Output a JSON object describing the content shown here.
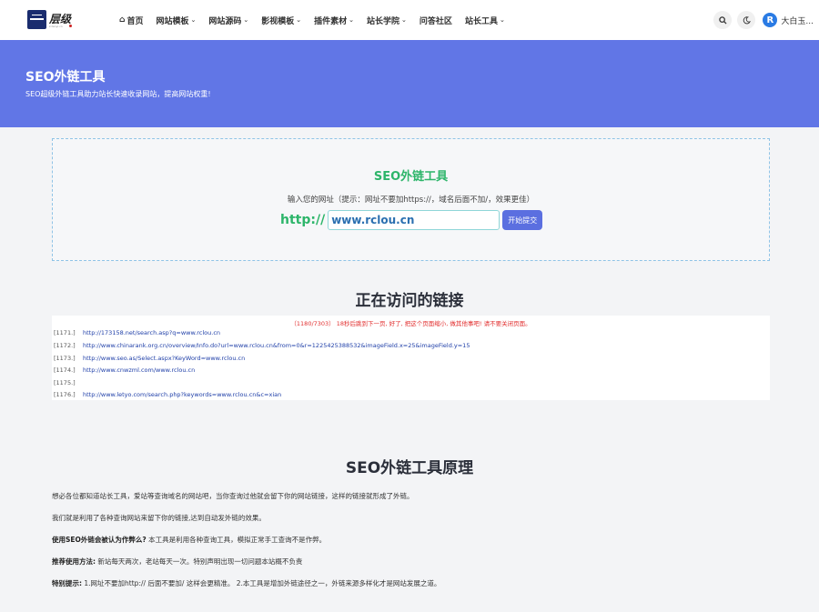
{
  "header": {
    "logo_text": "层级",
    "logo_sub": "z-tanyi.cn",
    "nav": [
      {
        "label": "首页",
        "has_menu": false,
        "icon": "home-icon"
      },
      {
        "label": "网站模板",
        "has_menu": true
      },
      {
        "label": "网站源码",
        "has_menu": true
      },
      {
        "label": "影视模板",
        "has_menu": true
      },
      {
        "label": "插件素材",
        "has_menu": true
      },
      {
        "label": "站长学院",
        "has_menu": true
      },
      {
        "label": "问答社区",
        "has_menu": false
      },
      {
        "label": "站长工具",
        "has_menu": true
      }
    ],
    "user_initial": "R",
    "user_name": "大白玉..."
  },
  "banner": {
    "title": "SEO外链工具",
    "subtitle": "SEO超级外链工具助力站长快速收录网站，提高网站权重!"
  },
  "tool": {
    "title": "SEO外链工具",
    "hint": "输入您的网址（提示：网址不要加https://，域名后面不加/，效果更佳）",
    "prefix": "http://",
    "url_value": "www.rclou.cn",
    "submit_label": "开始提交"
  },
  "visiting": {
    "title": "正在访问的链接",
    "status": "（1180/7303） 18秒后跳到下一页, 好了, 把这个页面缩小, 做其他事吧! 请不要关闭页面。",
    "logs": [
      {
        "idx": "[1171.]",
        "url": "http://173158.net/search.asp?q=www.rclou.cn"
      },
      {
        "idx": "[1172.]",
        "url": "http://www.chinarank.org.cn/overview/Info.do?url=www.rclou.cn&from=0&r=1225425388532&imageField.x=25&imageField.y=15"
      },
      {
        "idx": "[1173.]",
        "url": "http://www.seo.as/Select.aspx?KeyWord=www.rclou.cn"
      },
      {
        "idx": "[1174.]",
        "url": "http://www.cnwzml.com/www.rclou.cn"
      },
      {
        "idx": "[1175.]",
        "url": ""
      },
      {
        "idx": "[1176.]",
        "url": "http://www.letyo.com/search.php?keywords=www.rclou.cn&c=xian"
      }
    ]
  },
  "principles": {
    "title": "SEO外链工具原理",
    "p1": "想必各位都知道站长工具，爱站等查询域名的网站吧，当你查询过他就会留下你的网站链接，这样的链接就形成了外链。",
    "p2": "我们就是利用了各种查询网站来留下你的链接,达到自动发外链的效果。",
    "p3_bold": "使用SEO外链会被认为作弊么?",
    "p3": "本工具是利用各种查询工具，模拟正常手工查询不是作弊。",
    "p4_bold": "推荐使用方法:",
    "p4": "新站每天两次，老站每天一次。特别声明出现一切问题本站概不负责",
    "p5_bold": "特别提示:",
    "p5": "1.网址不要加http:// 后面不要加/ 这样会更精准。 2.本工具是增加外链途径之一，外链来源多样化才是网站发展之道。"
  },
  "colors": {
    "banner_bg": "#6176e6",
    "accent_green": "#2db56a",
    "button_blue": "#5b6fe0",
    "status_red": "#e23030",
    "link_blue": "#1f3fa8"
  }
}
